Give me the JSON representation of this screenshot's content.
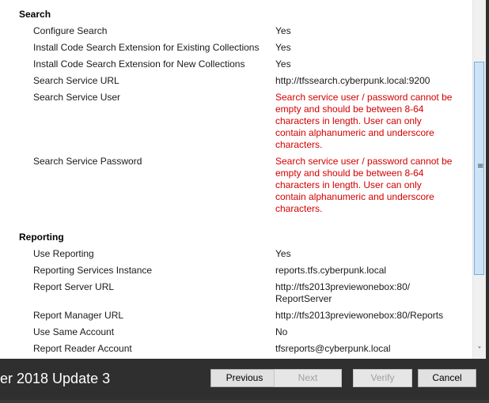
{
  "search": {
    "heading": "Search",
    "rows": [
      {
        "label": "Configure Search",
        "value": "Yes"
      },
      {
        "label": "Install Code Search Extension for Existing Collections",
        "value": "Yes"
      },
      {
        "label": "Install Code Search Extension for New Collections",
        "value": "Yes"
      },
      {
        "label": "Search Service URL",
        "value": "http://tfssearch.cyberpunk.local:9200"
      },
      {
        "label": "Search Service User",
        "value": "Search service user / password cannot be empty and should be between 8-64 characters in length. User can only contain alphanumeric and underscore characters."
      },
      {
        "label": "Search Service Password",
        "value": "Search service user / password cannot be empty and should be between 8-64 characters in length. User can only contain alphanumeric and underscore characters."
      }
    ]
  },
  "reporting": {
    "heading": "Reporting",
    "rows": [
      {
        "label": "Use Reporting",
        "value": "Yes"
      },
      {
        "label": "Reporting Services Instance",
        "value": "reports.tfs.cyberpunk.local"
      },
      {
        "label": "Report Server URL",
        "value": "http://tfs2013previewonebox:80/ ReportServer"
      },
      {
        "label": "Report Manager URL",
        "value": "http://tfs2013previewonebox:80/Reports"
      },
      {
        "label": "Use Same Account",
        "value": "No"
      },
      {
        "label": "Report Reader Account",
        "value": "tfsreports@cyberpunk.local"
      }
    ]
  },
  "footer": {
    "title": "er 2018 Update 3",
    "buttons": {
      "previous": "Previous",
      "next": "Next",
      "verify": "Verify",
      "cancel": "Cancel"
    }
  },
  "scrollbar": {
    "grip_icon": "grip-lines-icon",
    "down_icon": "chevron-down-icon"
  },
  "colors": {
    "error": "#d40000",
    "footer_bg": "#2f2f2f",
    "scroll_thumb": "#cde4f7"
  }
}
